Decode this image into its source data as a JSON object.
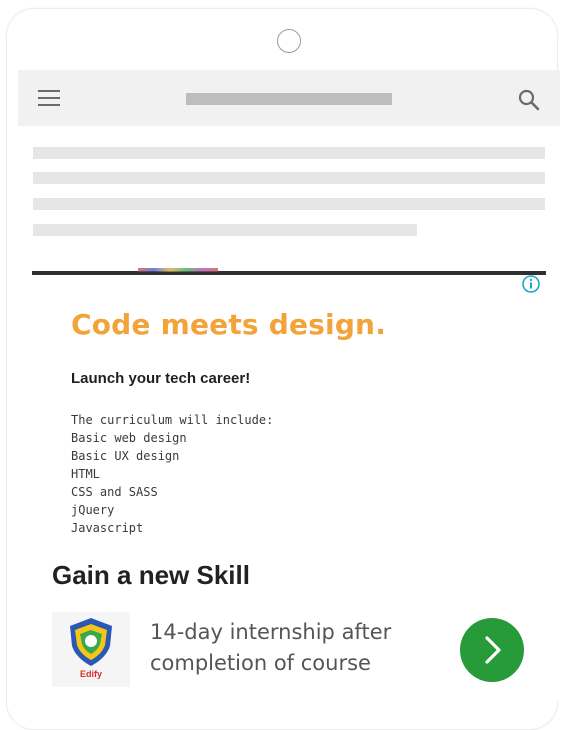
{
  "ad": {
    "headline": "Code meets design.",
    "subheadline": "Launch your tech career!",
    "curriculum": [
      "The curriculum will include:",
      "Basic web design",
      "Basic UX design",
      "HTML",
      "CSS and SASS",
      "jQuery",
      "Javascript"
    ],
    "info_icon": "info-icon",
    "headline_color": "#f2a33a"
  },
  "promo": {
    "title": "Gain a new Skill",
    "logo_label": "Edify",
    "description": "14-day internship after completion of course",
    "cta_icon": "chevron-right-icon",
    "cta_color": "#279a3a"
  },
  "appbar": {
    "menu_icon": "hamburger-menu-icon",
    "search_icon": "search-icon"
  }
}
